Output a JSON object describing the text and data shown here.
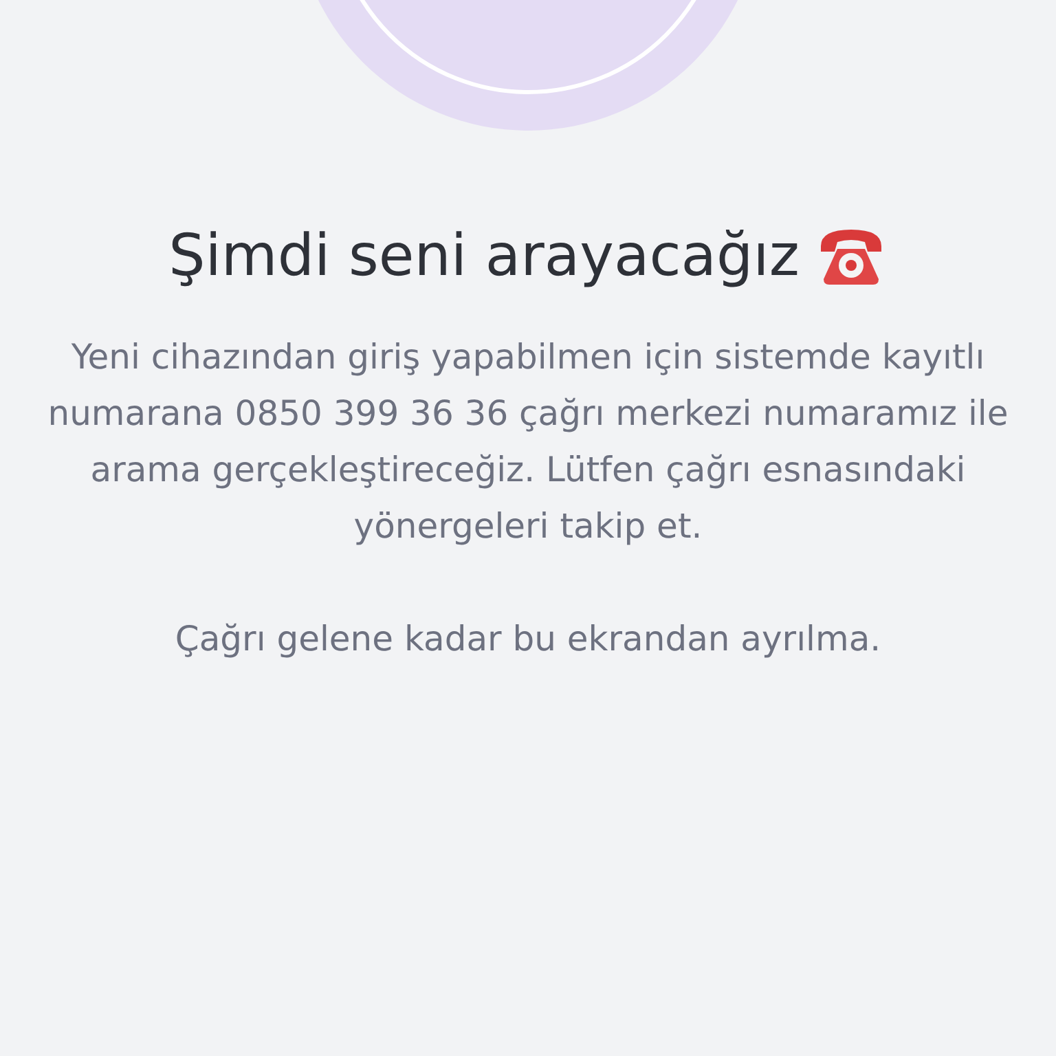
{
  "title": "Şimdi seni arayacağız",
  "body": "Yeni cihazından giriş yapabilmen için sistemde kayıtlı numarana 0850 399 36 36 çağrı merkezi numaramız ile arama gerçekleştireceğiz. Lütfen çağrı esnasındaki yönergeleri takip et.",
  "note": "Çağrı gelene kadar bu ekrandan ayrılma."
}
